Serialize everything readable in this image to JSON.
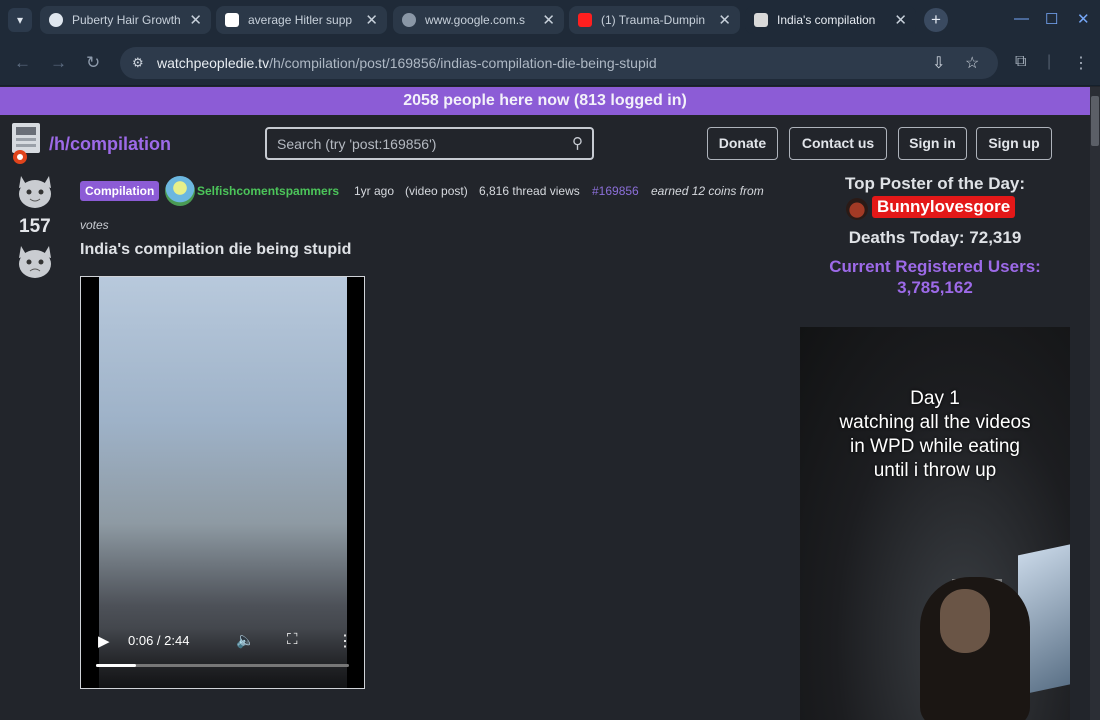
{
  "browser": {
    "tabs": [
      {
        "title": "Puberty Hair Growth",
        "active": false
      },
      {
        "title": "average Hitler supp",
        "active": false
      },
      {
        "title": "www.google.com.s",
        "active": false
      },
      {
        "title": "(1) Trauma-Dumpin",
        "active": false
      },
      {
        "title": "India's compilation",
        "active": true
      }
    ],
    "url_domain": "watchpeopledie.tv",
    "url_path": "/h/compilation/post/169856/indias-compilation-die-being-stupid"
  },
  "site": {
    "online_banner": "2058 people here now (813 logged in)",
    "hole_name": "/h/compilation",
    "search_placeholder": "Search (try 'post:169856')",
    "buttons": {
      "donate": "Donate",
      "contact": "Contact us",
      "signin": "Sign in",
      "signup": "Sign up"
    }
  },
  "post": {
    "vote_count": "157",
    "votes_label": "votes",
    "flair": "Compilation",
    "author": "Selfishcomentspammers",
    "age": "1yr ago",
    "post_type": "(video post)",
    "views": "6,816 thread views",
    "post_id": "#169856",
    "earned": "earned 12 coins from",
    "title": "India's compilation die being stupid",
    "video": {
      "current_time": "0:06",
      "duration": "2:44",
      "progress": 0.16
    }
  },
  "sidebar": {
    "top_poster_label": "Top Poster of the Day:",
    "top_poster_name": "Bunnylovesgore",
    "deaths_today": "Deaths Today: 72,319",
    "registered_label": "Current Registered Users:",
    "registered_count": "3,785,162",
    "promo_text": "Day 1\nwatching all the videos\nin WPD while eating\nuntil i throw up"
  }
}
